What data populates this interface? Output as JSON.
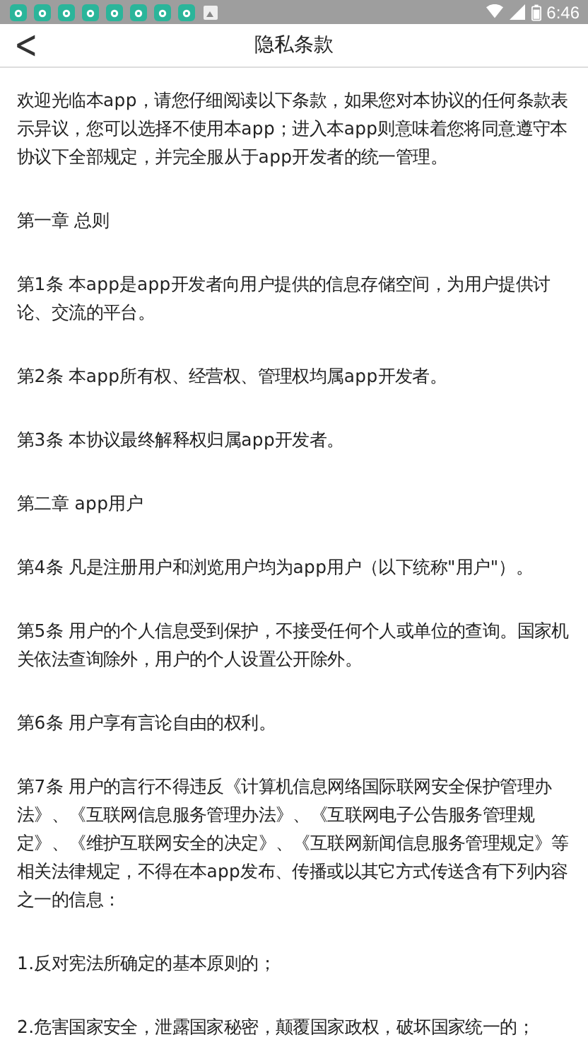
{
  "status_bar": {
    "time": "6:46"
  },
  "header": {
    "back": "<",
    "title": "隐私条款"
  },
  "paragraphs": [
    "欢迎光临本app，请您仔细阅读以下条款，如果您对本协议的任何条款表示异议，您可以选择不使用本app；进入本app则意味着您将同意遵守本协议下全部规定，并完全服从于app开发者的统一管理。",
    "第一章 总则",
    "第1条 本app是app开发者向用户提供的信息存储空间，为用户提供讨论、交流的平台。",
    "第2条 本app所有权、经营权、管理权均属app开发者。",
    "第3条 本协议最终解释权归属app开发者。",
    "第二章 app用户",
    "第4条 凡是注册用户和浏览用户均为app用户（以下统称\"用户\"）。",
    "第5条 用户的个人信息受到保护，不接受任何个人或单位的查询。国家机关依法查询除外，用户的个人设置公开除外。",
    "第6条 用户享有言论自由的权利。",
    "第7条 用户的言行不得违反《计算机信息网络国际联网安全保护管理办法》、《互联网信息服务管理办法》、《互联网电子公告服务管理规定》、《维护互联网安全的决定》、《互联网新闻信息服务管理规定》等相关法律规定，不得在本app发布、传播或以其它方式传送含有下列内容之一的信息：",
    "1.反对宪法所确定的基本原则的；",
    "2.危害国家安全，泄露国家秘密，颠覆国家政权，破坏国家统一的；"
  ]
}
